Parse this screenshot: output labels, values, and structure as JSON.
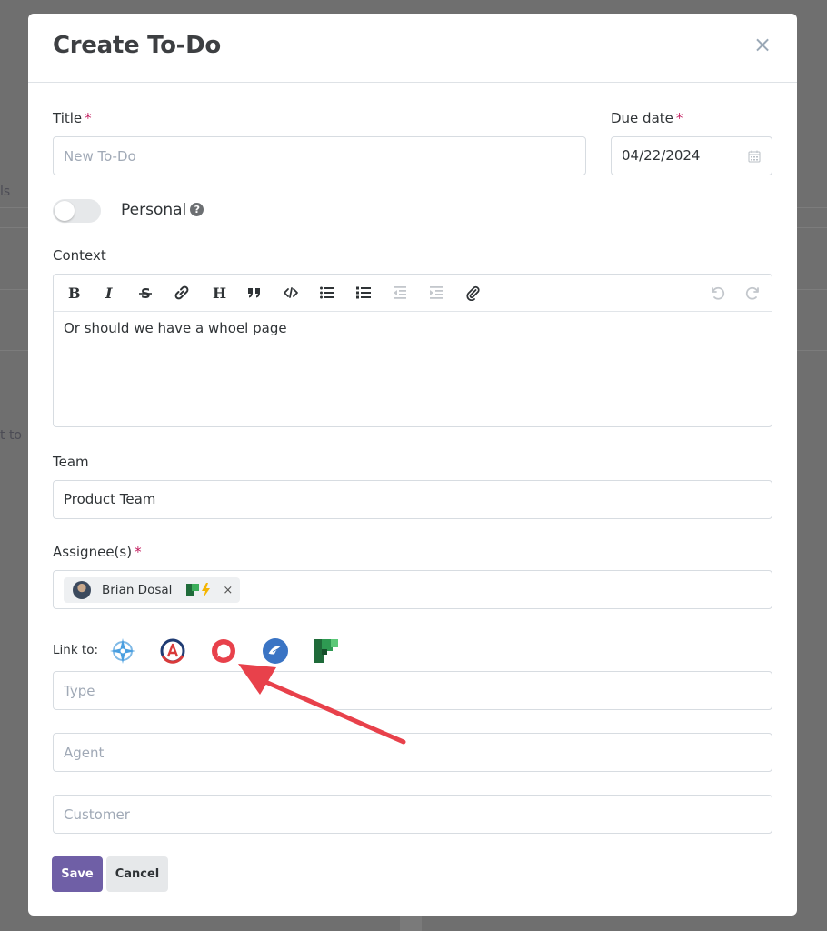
{
  "background": {
    "fragment_1": "ls",
    "fragment_2": "t to"
  },
  "modal": {
    "title": "Create To-Do",
    "close_label": "×"
  },
  "form": {
    "title_label": "Title",
    "title_placeholder": "New To-Do",
    "due_label": "Due date",
    "due_value": "04/22/2024",
    "required_mark": "*",
    "personal_label": "Personal",
    "personal_help": "?",
    "personal_on": false,
    "context_label": "Context",
    "context_text": "Or should we have a whoel page",
    "toolbar_icons": [
      "bold-icon",
      "italic-icon",
      "strikethrough-icon",
      "link-icon",
      "heading-icon",
      "quote-icon",
      "code-icon",
      "bullet-list-icon",
      "numbered-list-icon",
      "outdent-icon",
      "indent-icon",
      "attachment-icon",
      "undo-icon",
      "redo-icon"
    ],
    "team_label": "Team",
    "team_value": "Product Team",
    "assignee_label": "Assignee(s)",
    "assignee_name": "Brian Dosal",
    "chip_remove": "×",
    "link_to_label": "Link to:",
    "link_icons": [
      "compass-app-icon",
      "a-logo-app-icon",
      "chat-bubble-app-icon",
      "bird-app-icon",
      "green-squares-app-icon"
    ],
    "type_placeholder": "Type",
    "agent_placeholder": "Agent",
    "customer_placeholder": "Customer",
    "save_label": "Save",
    "cancel_label": "Cancel"
  },
  "colors": {
    "primary": "#6f5fa6",
    "required": "#c2185b",
    "annotation_arrow": "#e8414b"
  }
}
